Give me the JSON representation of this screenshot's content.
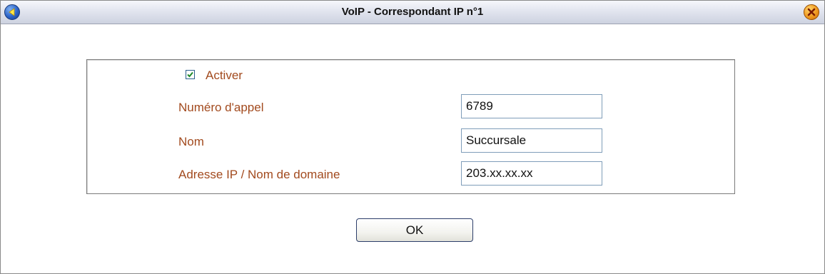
{
  "window": {
    "title": "VoIP - Correspondant IP n°1"
  },
  "form": {
    "activer": {
      "label": "Activer",
      "checked": true
    },
    "fields": [
      {
        "label": "Numéro d'appel",
        "value": "6789"
      },
      {
        "label": "Nom",
        "value": "Succursale"
      },
      {
        "label": "Adresse IP / Nom de domaine",
        "value": "203.xx.xx.xx"
      }
    ]
  },
  "actions": {
    "ok_label": "OK"
  },
  "icons": {
    "back": "back-arrow-icon",
    "close": "close-icon"
  },
  "colors": {
    "label_text": "#a24a1e",
    "back_button": "#2a62c8",
    "close_button": "#f09a20",
    "checkmark": "#1f8a2a"
  }
}
